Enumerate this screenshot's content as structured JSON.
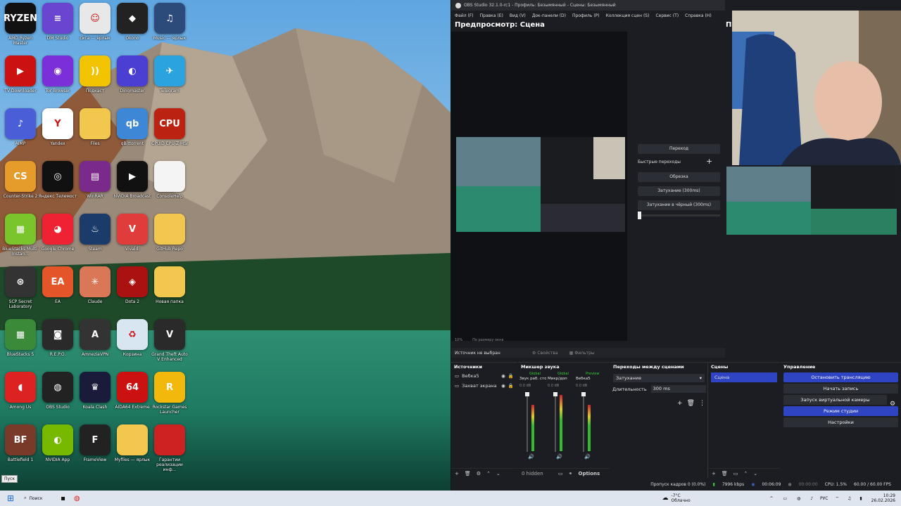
{
  "desktop": {
    "icons": [
      {
        "label": "AMD Ryzen Master",
        "color": "#111",
        "glyph": "RYZEN"
      },
      {
        "label": "DM Studio",
        "color": "#6a45d0",
        "glyph": "≡"
      },
      {
        "label": "сига — ярлык",
        "color": "#e8e8e8",
        "glyph": "☺"
      },
      {
        "label": "Okono",
        "color": "#222",
        "glyph": "◆"
      },
      {
        "label": "Music — ярлык",
        "color": "#2c4a7a",
        "glyph": "♫"
      },
      {
        "label": "TV Downloader",
        "color": "#c11",
        "glyph": "▶"
      },
      {
        "label": "Tor Browser",
        "color": "#7a2fd8",
        "glyph": "◉"
      },
      {
        "label": "Подкаст",
        "color": "#f2c400",
        "glyph": "))"
      },
      {
        "label": "Dingmaster",
        "color": "#4b3fd3",
        "glyph": "◐"
      },
      {
        "label": "Telegram",
        "color": "#2aa3de",
        "glyph": "✈"
      },
      {
        "label": "AIMP",
        "color": "#4a5ed8",
        "glyph": "♪"
      },
      {
        "label": "Yandex",
        "color": "#fff",
        "glyph": "Y"
      },
      {
        "label": "Files",
        "color": "#f1c84d",
        "glyph": ""
      },
      {
        "label": "qBittorrent",
        "color": "#3d87d6",
        "glyph": "qb"
      },
      {
        "label": "CPUID CPU-Z MSI",
        "color": "#b21",
        "glyph": "CPU"
      },
      {
        "label": "Counter-Strike 2",
        "color": "#e69c2a",
        "glyph": "CS"
      },
      {
        "label": "Яндекс Телемост",
        "color": "#111",
        "glyph": "◎"
      },
      {
        "label": "WinRAR",
        "color": "#7a2a8a",
        "glyph": "▤"
      },
      {
        "label": "NVIDIA Broadcast",
        "color": "#111",
        "glyph": "▶"
      },
      {
        "label": "ConsoleHelp",
        "color": "#f4f4f4",
        "glyph": ""
      },
      {
        "label": "BlueStacks Multi-Instan...",
        "color": "#7ac52c",
        "glyph": "▦"
      },
      {
        "label": "Google Chrome",
        "color": "#e23",
        "glyph": "◕"
      },
      {
        "label": "Steam",
        "color": "#1b3b6a",
        "glyph": "♨"
      },
      {
        "label": "Vivaldi",
        "color": "#e03c3c",
        "glyph": "V"
      },
      {
        "label": "GitHub Repo",
        "color": "#f1c84d",
        "glyph": ""
      },
      {
        "label": "SCP Secret Laboratory",
        "color": "#333",
        "glyph": "⊛"
      },
      {
        "label": "EA",
        "color": "#e4552a",
        "glyph": "EA"
      },
      {
        "label": "Claude",
        "color": "#d97757",
        "glyph": "✳"
      },
      {
        "label": "Dota 2",
        "color": "#a11",
        "glyph": "◈"
      },
      {
        "label": "Новая папка",
        "color": "#f1c84d",
        "glyph": ""
      },
      {
        "label": "BlueStacks 5",
        "color": "#3a8a3a",
        "glyph": "▦"
      },
      {
        "label": "R.E.P.O.",
        "color": "#2a2a2a",
        "glyph": "◙"
      },
      {
        "label": "AmneziaVPN",
        "color": "#333",
        "glyph": "A"
      },
      {
        "label": "Корзина",
        "color": "#d8e6f2",
        "glyph": "♻"
      },
      {
        "label": "Grand Theft Auto V Enhanced",
        "color": "#2a2a2a",
        "glyph": "V"
      },
      {
        "label": "Among Us",
        "color": "#d22",
        "glyph": "◖"
      },
      {
        "label": "OBS Studio",
        "color": "#222",
        "glyph": "◍"
      },
      {
        "label": "Koala Clash",
        "color": "#1a1a3a",
        "glyph": "♛"
      },
      {
        "label": "AIDA64 Extreme",
        "color": "#c11",
        "glyph": "64"
      },
      {
        "label": "Rockstar Games Launcher",
        "color": "#f2b90c",
        "glyph": "R"
      },
      {
        "label": "Battlefield 1",
        "color": "#7a3a2a",
        "glyph": "BF"
      },
      {
        "label": "NVIDIA App",
        "color": "#76b900",
        "glyph": "◐"
      },
      {
        "label": "FrameView",
        "color": "#222",
        "glyph": "F"
      },
      {
        "label": "Myfiles — ярлык",
        "color": "#f1c84d",
        "glyph": ""
      },
      {
        "label": "Гарантии реализации инф...",
        "color": "#c22",
        "glyph": ""
      }
    ],
    "pusk_label": "Пуск"
  },
  "obs": {
    "title": "OBS Studio 32.1.0-rc1 - Профиль: Безымянный - Сцены: Безымянный",
    "menu": [
      "Файл (F)",
      "Правка (E)",
      "Вид (V)",
      "Док-панели (D)",
      "Профиль (P)",
      "Коллекция сцен (S)",
      "Сервис (T)",
      "Справка (H)"
    ],
    "preview_title": "Предпросмотр: Сцена",
    "program_title_cut": "Пр",
    "zoom_label": "10%",
    "zoom_mode": "По размеру окна",
    "transition": {
      "button": "Переход",
      "quick_label": "Быстрые переходы",
      "items": [
        "Обрезка",
        "Затухание (300ms)",
        "Затухание в чёрный (300ms)"
      ]
    },
    "source_bar": {
      "status": "Источник не выбран",
      "properties": "Свойства",
      "filters": "Фильтры"
    },
    "sources": {
      "title": "Источники",
      "items": [
        "Вебка5",
        "Захват экрана"
      ]
    },
    "mixer": {
      "title": "Микшер звука",
      "tags": [
        "Global",
        "Global",
        "Preview"
      ],
      "channels": [
        "Звук раб. стола",
        "Микр/доп",
        "Вебка5"
      ],
      "db": [
        "0.0 dB",
        "0.0 dB",
        "0.0 dB"
      ],
      "scale": [
        "0",
        "-6",
        "-12",
        "-18",
        "-24",
        "-30",
        "-36",
        "-42",
        "-48",
        "-54",
        "-60"
      ],
      "footer_hidden": "0 hidden",
      "footer_options": "Options"
    },
    "scene_transitions": {
      "title": "Переходы между сценами",
      "selected": "Затухание",
      "duration_label": "Длительность",
      "duration_value": "300 ms"
    },
    "scenes": {
      "title": "Сцены",
      "items": [
        "Сцена"
      ]
    },
    "controls": {
      "title": "Управление",
      "buttons": [
        {
          "label": "Остановить трансляцию",
          "active": true
        },
        {
          "label": "Начать запись",
          "active": false
        },
        {
          "label": "Запуск виртуальной камеры",
          "active": false
        },
        {
          "label": "Режим студии",
          "active": true
        },
        {
          "label": "Настройки",
          "active": false
        }
      ]
    },
    "status": {
      "dropped": "Пропуск кадров 0 (0.0%)",
      "bitrate": "7996 kbps",
      "stream_time": "00:06:09",
      "rec_time": "00:00:00",
      "cpu": "CPU: 1.5%",
      "fps": "60.00 / 60.00 FPS"
    }
  },
  "taskbar": {
    "search": "Поиск",
    "weather_temp": "-7°C",
    "weather_desc": "Облачно",
    "lang": "РУС",
    "time": "10:29",
    "date": "26.02.2026"
  }
}
